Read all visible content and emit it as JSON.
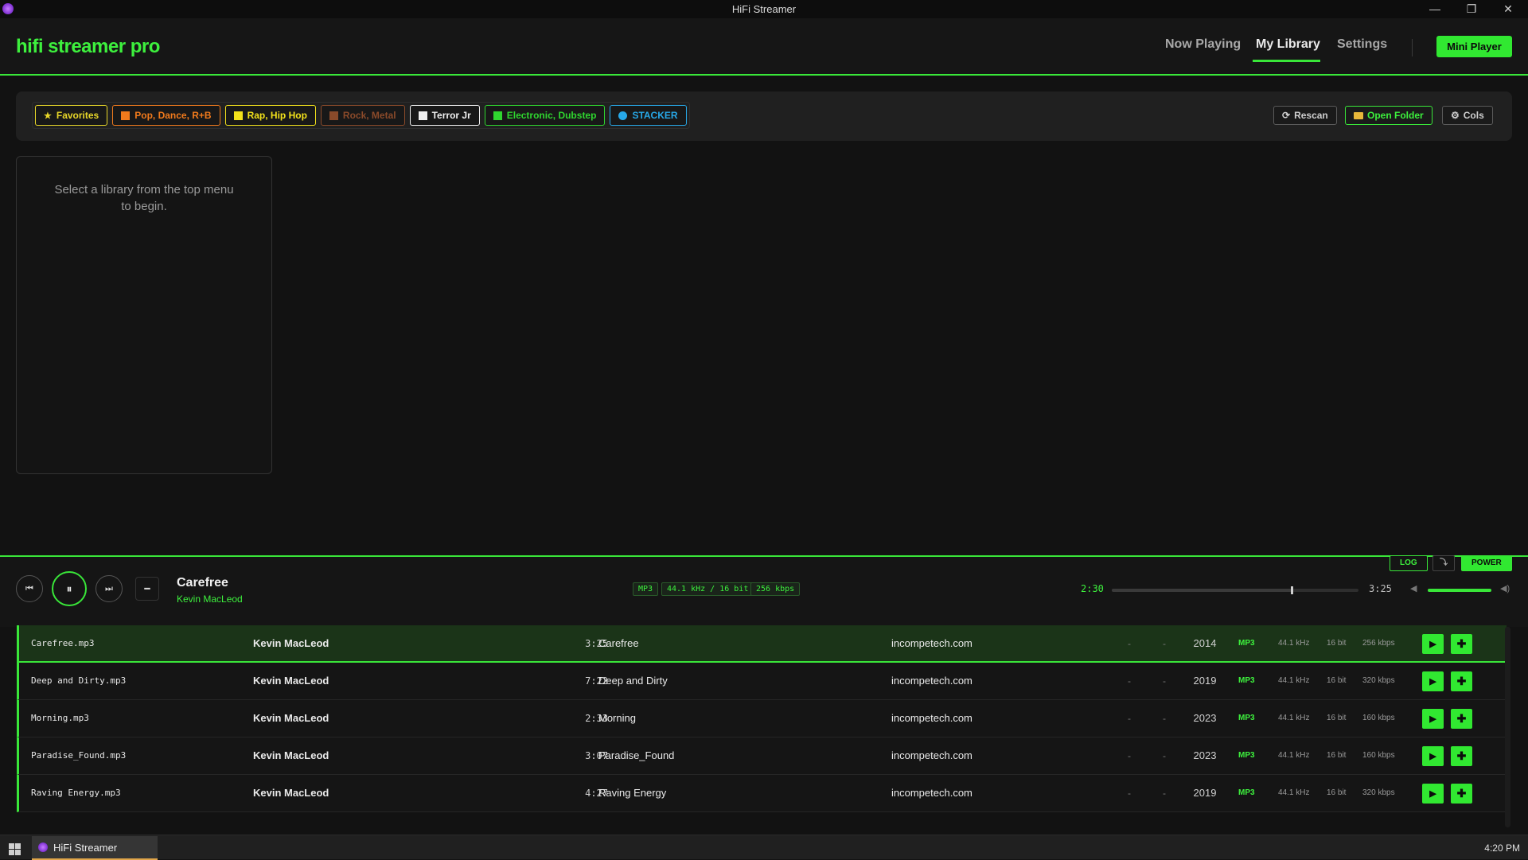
{
  "window": {
    "title": "HiFi Streamer",
    "min": "—",
    "restore": "❐",
    "close": "✕"
  },
  "header": {
    "brand": "hifi streamer pro",
    "nav": [
      "Now Playing",
      "My Library",
      "Settings"
    ],
    "active_nav": "My Library",
    "mini_player": "Mini Player",
    "accent": "#39e639"
  },
  "toolbar": {
    "chips": [
      {
        "label": "Favorites",
        "icon": "star-icon",
        "glyph": "★",
        "color": "#e7d629"
      },
      {
        "label": "Pop, Dance, R+B",
        "icon": "swatch",
        "color": "#f07a1c"
      },
      {
        "label": "Rap, Hip Hop",
        "icon": "swatch",
        "color": "#f2e11b"
      },
      {
        "label": "Rock, Metal",
        "icon": "swatch",
        "color": "#8a4a2a"
      },
      {
        "label": "Terror Jr",
        "icon": "swatch",
        "color": "#f0f0f0"
      },
      {
        "label": "Electronic, Dubstep",
        "icon": "swatch",
        "color": "#2fd62f"
      },
      {
        "label": "STACKER",
        "icon": "dot",
        "color": "#27a8e8"
      }
    ],
    "rescan": "Rescan",
    "open_folder": "Open Folder",
    "cols": "Cols"
  },
  "library_panel": {
    "message": "Select a library from the top menu to begin."
  },
  "player": {
    "title": "Carefree",
    "artist": "Kevin MacLeod",
    "format": "MP3",
    "quality": "44.1 kHz / 16 bit",
    "bitrate": "256 kbps",
    "elapsed": "2:30",
    "total": "3:25",
    "progress": 0.73,
    "volume": 1.0,
    "log": "LOG",
    "power": "POWER",
    "mini_toggle": "⤵"
  },
  "tracks": [
    {
      "file": "Carefree.mp3",
      "artist": "Kevin MacLeod",
      "duration": "3:25",
      "title": "Carefree",
      "album": "incompetech.com",
      "d1": "-",
      "d2": "-",
      "year": "2014",
      "format": "MP3",
      "rate": "44.1 kHz",
      "bits": "16 bit",
      "kbps": "256 kbps"
    },
    {
      "file": "Deep and Dirty.mp3",
      "artist": "Kevin MacLeod",
      "duration": "7:22",
      "title": "Deep and Dirty",
      "album": "incompetech.com",
      "d1": "-",
      "d2": "-",
      "year": "2019",
      "format": "MP3",
      "rate": "44.1 kHz",
      "bits": "16 bit",
      "kbps": "320 kbps"
    },
    {
      "file": "Morning.mp3",
      "artist": "Kevin MacLeod",
      "duration": "2:33",
      "title": "Morning",
      "album": "incompetech.com",
      "d1": "-",
      "d2": "-",
      "year": "2023",
      "format": "MP3",
      "rate": "44.1 kHz",
      "bits": "16 bit",
      "kbps": "160 kbps"
    },
    {
      "file": "Paradise_Found.mp3",
      "artist": "Kevin MacLeod",
      "duration": "3:07",
      "title": "Paradise_Found",
      "album": "incompetech.com",
      "d1": "-",
      "d2": "-",
      "year": "2023",
      "format": "MP3",
      "rate": "44.1 kHz",
      "bits": "16 bit",
      "kbps": "160 kbps"
    },
    {
      "file": "Raving Energy.mp3",
      "artist": "Kevin MacLeod",
      "duration": "4:27",
      "title": "Raving Energy",
      "album": "incompetech.com",
      "d1": "-",
      "d2": "-",
      "year": "2019",
      "format": "MP3",
      "rate": "44.1 kHz",
      "bits": "16 bit",
      "kbps": "320 kbps"
    }
  ],
  "taskbar": {
    "app": "HiFi Streamer",
    "clock": "4:20 PM"
  }
}
